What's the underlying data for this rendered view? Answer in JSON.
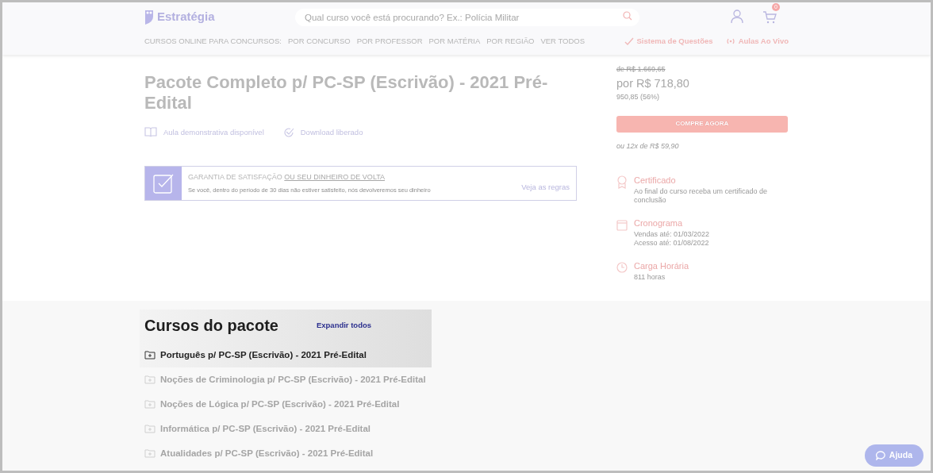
{
  "header": {
    "logo": "Estratégia",
    "search": {
      "placeholder": "Qual curso você está procurando? Ex.: Polícia Militar"
    },
    "cart_count": "0",
    "nav_label": "CURSOS ONLINE PARA CONCURSOS:",
    "nav": [
      "POR CONCURSO",
      "POR PROFESSOR",
      "POR MATÉRIA",
      "POR REGIÃO",
      "VER TODOS"
    ],
    "extra_links": [
      {
        "kind": "check",
        "label": "Sistema de Questões"
      },
      {
        "kind": "live",
        "label": "Aulas Ao Vivo"
      }
    ]
  },
  "product": {
    "title": "Pacote Completo p/ PC-SP (Escrivão) - 2021 Pré-Edital",
    "features": [
      {
        "kind": "book",
        "label": "Aula demonstrativa disponível"
      },
      {
        "kind": "check",
        "label": "Download liberado"
      }
    ],
    "guarantee": {
      "title": "GARANTIA DE SATISFAÇÃO",
      "title_link": "OU SEU DINHEIRO DE VOLTA",
      "text": "Se você, dentro do período de 30 dias não estiver satisfeito, nós devolveremos seu dinheiro",
      "link": "Veja as regras"
    }
  },
  "purchase": {
    "old_price": "de R$ 1.669,65",
    "price": "por R$ 718,80",
    "discount": "950,85 (56%)",
    "button": "COMPRE AGORA",
    "installments": "ou 12x de R$ 59,90",
    "info": [
      {
        "kind": "certificate",
        "title": "Certificado",
        "lines": [
          "Ao final do curso receba um certificado de conclusão"
        ]
      },
      {
        "kind": "calendar",
        "title": "Cronograma",
        "lines": [
          "Vendas até: 01/03/2022",
          "Acesso até: 01/08/2022"
        ]
      },
      {
        "kind": "clock",
        "title": "Carga Horária",
        "lines": [
          "811 horas"
        ]
      }
    ]
  },
  "package": {
    "title": "Cursos do pacote",
    "expand": "Expandir todos",
    "courses": [
      {
        "label": "Português p/ PC-SP (Escrivão) - 2021 Pré-Edital",
        "highlighted": true
      },
      {
        "label": "Noções de Criminologia p/ PC-SP (Escrivão) - 2021 Pré-Edital",
        "highlighted": false
      },
      {
        "label": "Noções de Lógica p/ PC-SP (Escrivão) - 2021 Pré-Edital",
        "highlighted": false
      },
      {
        "label": "Informática p/ PC-SP (Escrivão) - 2021 Pré-Edital",
        "highlighted": false
      },
      {
        "label": "Atualidades p/ PC-SP (Escrivão) - 2021 Pré-Edital",
        "highlighted": false
      }
    ]
  },
  "help_button": "Ajuda"
}
